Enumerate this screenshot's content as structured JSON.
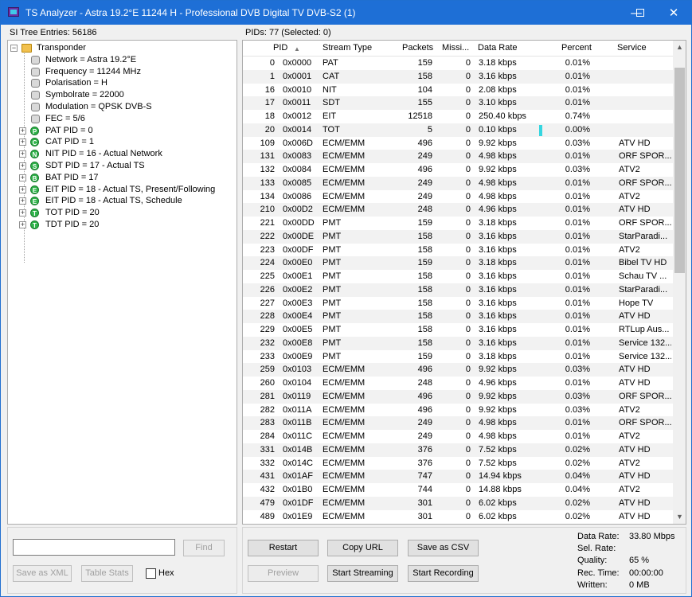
{
  "window": {
    "title": "TS Analyzer - Astra 19.2°E 11244 H - Professional DVB Digital TV DVB-S2 (1)",
    "minimize": "—",
    "maximize": "☐",
    "close": "✕"
  },
  "si_tree": {
    "label": "SI Tree Entries: 56186",
    "root": "Transponder",
    "children": [
      "Network = Astra 19.2°E",
      "Frequency = 11244 MHz",
      "Polarisation = H",
      "Symbolrate = 22000",
      "Modulation = QPSK DVB-S",
      "FEC = 5/6"
    ],
    "nodes": [
      {
        "letter": "P",
        "label": "PAT PID = 0"
      },
      {
        "letter": "C",
        "label": "CAT PID = 1"
      },
      {
        "letter": "N",
        "label": "NIT PID = 16 - Actual Network"
      },
      {
        "letter": "S",
        "label": "SDT PID = 17 - Actual TS"
      },
      {
        "letter": "B",
        "label": "BAT PID = 17"
      },
      {
        "letter": "E",
        "label": "EIT PID = 18 - Actual TS, Present/Following"
      },
      {
        "letter": "E",
        "label": "EIT PID = 18 - Actual TS, Schedule"
      },
      {
        "letter": "T",
        "label": "TOT PID = 20"
      },
      {
        "letter": "T",
        "label": "TDT PID = 20"
      }
    ]
  },
  "pids": {
    "label": "PIDs: 77  (Selected: 0)",
    "columns": [
      "PID",
      "Stream Type",
      "Packets",
      "Missi...",
      "Data Rate",
      "Percent",
      "Service"
    ],
    "sort_icon": "▲",
    "rows": [
      [
        "0",
        "0x0000",
        "PAT",
        "159",
        "0",
        "3.18 kbps",
        "0.01%",
        ""
      ],
      [
        "1",
        "0x0001",
        "CAT",
        "158",
        "0",
        "3.16 kbps",
        "0.01%",
        ""
      ],
      [
        "16",
        "0x0010",
        "NIT",
        "104",
        "0",
        "2.08 kbps",
        "0.01%",
        ""
      ],
      [
        "17",
        "0x0011",
        "SDT",
        "155",
        "0",
        "3.10 kbps",
        "0.01%",
        ""
      ],
      [
        "18",
        "0x0012",
        "EIT",
        "12518",
        "0",
        "250.40 kbps",
        "0.74%",
        ""
      ],
      [
        "20",
        "0x0014",
        "TOT",
        "5",
        "0",
        "0.10 kbps",
        "0.00%",
        ""
      ],
      [
        "109",
        "0x006D",
        "ECM/EMM",
        "496",
        "0",
        "9.92 kbps",
        "0.03%",
        "ATV HD"
      ],
      [
        "131",
        "0x0083",
        "ECM/EMM",
        "249",
        "0",
        "4.98 kbps",
        "0.01%",
        "ORF SPOR..."
      ],
      [
        "132",
        "0x0084",
        "ECM/EMM",
        "496",
        "0",
        "9.92 kbps",
        "0.03%",
        "ATV2"
      ],
      [
        "133",
        "0x0085",
        "ECM/EMM",
        "249",
        "0",
        "4.98 kbps",
        "0.01%",
        "ORF SPOR..."
      ],
      [
        "134",
        "0x0086",
        "ECM/EMM",
        "249",
        "0",
        "4.98 kbps",
        "0.01%",
        "ATV2"
      ],
      [
        "210",
        "0x00D2",
        "ECM/EMM",
        "248",
        "0",
        "4.96 kbps",
        "0.01%",
        "ATV HD"
      ],
      [
        "221",
        "0x00DD",
        "PMT",
        "159",
        "0",
        "3.18 kbps",
        "0.01%",
        "ORF SPOR..."
      ],
      [
        "222",
        "0x00DE",
        "PMT",
        "158",
        "0",
        "3.16 kbps",
        "0.01%",
        "StarParadi..."
      ],
      [
        "223",
        "0x00DF",
        "PMT",
        "158",
        "0",
        "3.16 kbps",
        "0.01%",
        "ATV2"
      ],
      [
        "224",
        "0x00E0",
        "PMT",
        "159",
        "0",
        "3.18 kbps",
        "0.01%",
        "Bibel TV HD"
      ],
      [
        "225",
        "0x00E1",
        "PMT",
        "158",
        "0",
        "3.16 kbps",
        "0.01%",
        "Schau TV ..."
      ],
      [
        "226",
        "0x00E2",
        "PMT",
        "158",
        "0",
        "3.16 kbps",
        "0.01%",
        "StarParadi..."
      ],
      [
        "227",
        "0x00E3",
        "PMT",
        "158",
        "0",
        "3.16 kbps",
        "0.01%",
        "Hope TV"
      ],
      [
        "228",
        "0x00E4",
        "PMT",
        "158",
        "0",
        "3.16 kbps",
        "0.01%",
        "ATV HD"
      ],
      [
        "229",
        "0x00E5",
        "PMT",
        "158",
        "0",
        "3.16 kbps",
        "0.01%",
        "RTLup Aus..."
      ],
      [
        "232",
        "0x00E8",
        "PMT",
        "158",
        "0",
        "3.16 kbps",
        "0.01%",
        "Service 132..."
      ],
      [
        "233",
        "0x00E9",
        "PMT",
        "159",
        "0",
        "3.18 kbps",
        "0.01%",
        "Service 132..."
      ],
      [
        "259",
        "0x0103",
        "ECM/EMM",
        "496",
        "0",
        "9.92 kbps",
        "0.03%",
        "ATV HD"
      ],
      [
        "260",
        "0x0104",
        "ECM/EMM",
        "248",
        "0",
        "4.96 kbps",
        "0.01%",
        "ATV HD"
      ],
      [
        "281",
        "0x0119",
        "ECM/EMM",
        "496",
        "0",
        "9.92 kbps",
        "0.03%",
        "ORF SPOR..."
      ],
      [
        "282",
        "0x011A",
        "ECM/EMM",
        "496",
        "0",
        "9.92 kbps",
        "0.03%",
        "ATV2"
      ],
      [
        "283",
        "0x011B",
        "ECM/EMM",
        "249",
        "0",
        "4.98 kbps",
        "0.01%",
        "ORF SPOR..."
      ],
      [
        "284",
        "0x011C",
        "ECM/EMM",
        "249",
        "0",
        "4.98 kbps",
        "0.01%",
        "ATV2"
      ],
      [
        "331",
        "0x014B",
        "ECM/EMM",
        "376",
        "0",
        "7.52 kbps",
        "0.02%",
        "ATV HD"
      ],
      [
        "332",
        "0x014C",
        "ECM/EMM",
        "376",
        "0",
        "7.52 kbps",
        "0.02%",
        "ATV2"
      ],
      [
        "431",
        "0x01AF",
        "ECM/EMM",
        "747",
        "0",
        "14.94 kbps",
        "0.04%",
        "ATV HD"
      ],
      [
        "432",
        "0x01B0",
        "ECM/EMM",
        "744",
        "0",
        "14.88 kbps",
        "0.04%",
        "ATV2"
      ],
      [
        "479",
        "0x01DF",
        "ECM/EMM",
        "301",
        "0",
        "6.02 kbps",
        "0.02%",
        "ATV HD"
      ],
      [
        "489",
        "0x01E9",
        "ECM/EMM",
        "301",
        "0",
        "6.02 kbps",
        "0.02%",
        "ATV HD"
      ]
    ],
    "eit_bar_fraction": 0.0074
  },
  "find": {
    "value": "",
    "button": "Find"
  },
  "left_buttons": {
    "save_xml": "Save as XML",
    "table_stats": "Table Stats",
    "hex": "Hex"
  },
  "right_buttons": {
    "restart": "Restart",
    "copy_url": "Copy URL",
    "save_csv": "Save as CSV",
    "preview": "Preview",
    "start_streaming": "Start Streaming",
    "start_recording": "Start Recording"
  },
  "stats": [
    {
      "label": "Data Rate:",
      "value": "33.80 Mbps"
    },
    {
      "label": "Sel. Rate:",
      "value": ""
    },
    {
      "label": "Quality:",
      "value": "65 %"
    },
    {
      "label": "Rec. Time:",
      "value": "00:00:00"
    },
    {
      "label": "Written:",
      "value": "0 MB"
    }
  ],
  "scroll": {
    "up": "▲",
    "down": "▼"
  },
  "colors": {
    "titlebar": "#1e6fd6",
    "node_green": "#2fb34a",
    "bar": "#36d6e0"
  }
}
